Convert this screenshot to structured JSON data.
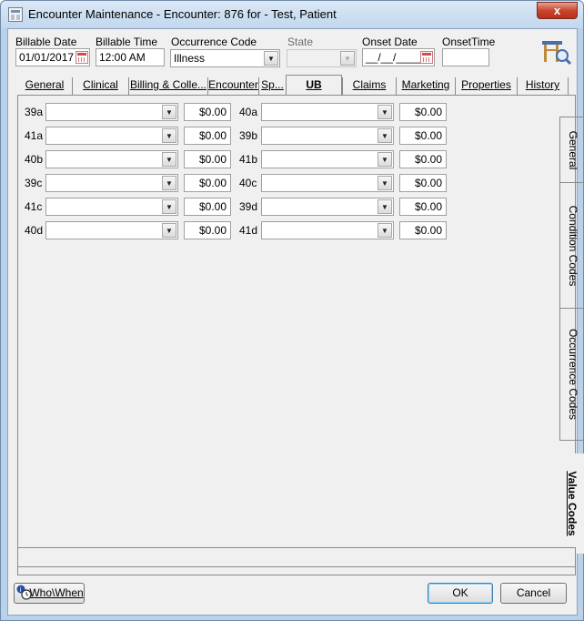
{
  "window": {
    "title": "Encounter Maintenance - Encounter: 876 for - Test, Patient",
    "close_label": "x"
  },
  "header": {
    "billable_date": {
      "label": "Billable Date",
      "value": "01/01/2017"
    },
    "billable_time": {
      "label": "Billable Time",
      "value": "12:00 AM"
    },
    "occurrence_code": {
      "label": "Occurrence Code",
      "value": "Illness"
    },
    "state": {
      "label": "State",
      "value": ""
    },
    "onset_date": {
      "label": "Onset Date",
      "value": "__/__/____"
    },
    "onset_time": {
      "label": "OnsetTime",
      "value": ""
    }
  },
  "tabs": [
    "General",
    "Clinical",
    "Billing & Colle...",
    "Encounter",
    "Sp...",
    "UB",
    "Claims",
    "Marketing",
    "Properties",
    "History"
  ],
  "value_codes": {
    "left": [
      {
        "code": "39a",
        "value": "",
        "amount": "$0.00"
      },
      {
        "code": "41a",
        "value": "",
        "amount": "$0.00"
      },
      {
        "code": "40b",
        "value": "",
        "amount": "$0.00"
      },
      {
        "code": "39c",
        "value": "",
        "amount": "$0.00"
      },
      {
        "code": "41c",
        "value": "",
        "amount": "$0.00"
      },
      {
        "code": "40d",
        "value": "",
        "amount": "$0.00"
      }
    ],
    "right": [
      {
        "code": "40a",
        "value": "",
        "amount": "$0.00"
      },
      {
        "code": "39b",
        "value": "",
        "amount": "$0.00"
      },
      {
        "code": "41b",
        "value": "",
        "amount": "$0.00"
      },
      {
        "code": "40c",
        "value": "",
        "amount": "$0.00"
      },
      {
        "code": "39d",
        "value": "",
        "amount": "$0.00"
      },
      {
        "code": "41d",
        "value": "",
        "amount": "$0.00"
      }
    ]
  },
  "side_tabs": [
    "General",
    "Condition Codes",
    "Occurrence Codes",
    "Value Codes"
  ],
  "footer": {
    "who_when": "Who\\When",
    "ok": "OK",
    "cancel": "Cancel"
  },
  "colors": {
    "accent": "#3c7fb1",
    "frame": "#b9d1ea"
  }
}
